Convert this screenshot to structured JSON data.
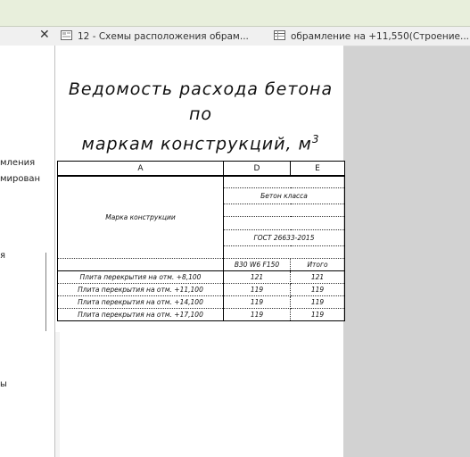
{
  "tabs": [
    {
      "label": "12 - Схемы расположения обрам...",
      "icon": "sheet-icon"
    },
    {
      "label": "обрамление на +11,550(Строение...",
      "icon": "schedule-icon"
    }
  ],
  "browser": {
    "close_glyph": "✕",
    "items": [
      "мления",
      "мирован",
      "я",
      "ы"
    ]
  },
  "title": {
    "line1": "Ведомость расхода бетона по",
    "line2": "маркам конструкций, м",
    "sup": "3"
  },
  "schedule": {
    "columns": [
      "A",
      "D",
      "E"
    ],
    "header_left": "Марка конструкции",
    "concrete_class": "Бетон класса",
    "gost": "ГОСТ 26633-2015",
    "sub_d": "В30 W6 F150",
    "sub_e": "Итого",
    "rows": [
      {
        "name": "Плита перекрытия на отм. +8,100",
        "d": "121",
        "e": "121"
      },
      {
        "name": "Плита перекрытия на отм. +11,100",
        "d": "119",
        "e": "119"
      },
      {
        "name": "Плита перекрытия на отм. +14,100",
        "d": "119",
        "e": "119"
      },
      {
        "name": "Плита перекрытия на отм. +17,100",
        "d": "119",
        "e": "119"
      }
    ]
  }
}
